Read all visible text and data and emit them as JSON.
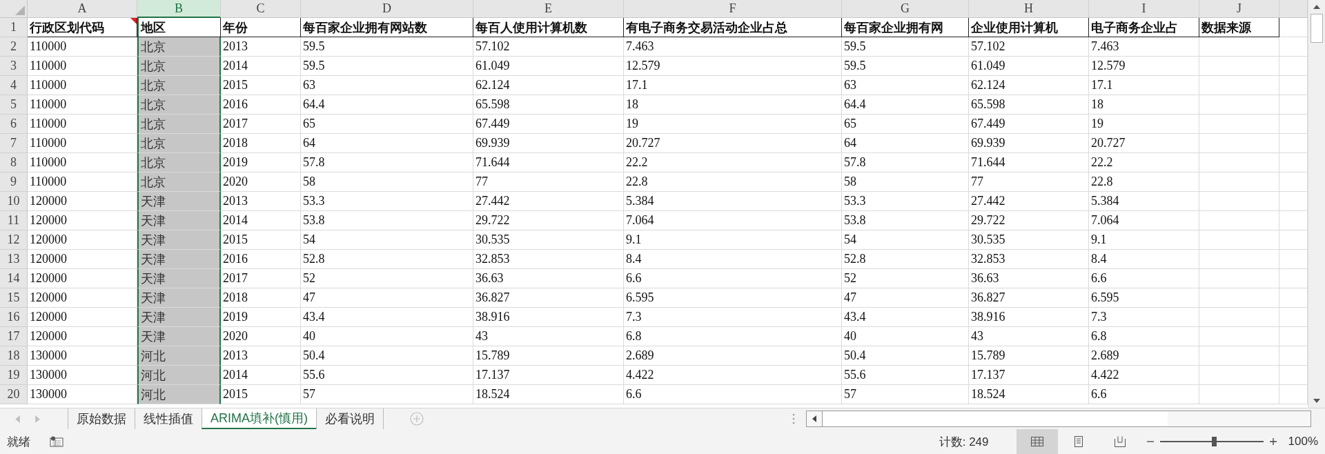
{
  "columns": [
    {
      "letter": "A",
      "selected": false
    },
    {
      "letter": "B",
      "selected": true
    },
    {
      "letter": "C",
      "selected": false
    },
    {
      "letter": "D",
      "selected": false
    },
    {
      "letter": "E",
      "selected": false
    },
    {
      "letter": "F",
      "selected": false
    },
    {
      "letter": "G",
      "selected": false
    },
    {
      "letter": "H",
      "selected": false
    },
    {
      "letter": "I",
      "selected": false
    },
    {
      "letter": "J",
      "selected": false
    }
  ],
  "header_row": {
    "number": "1",
    "cells": [
      {
        "text": "行政区划代码",
        "comment": true
      },
      {
        "text": "地区",
        "comment": false
      },
      {
        "text": "年份",
        "comment": false
      },
      {
        "text": "每百家企业拥有网站数",
        "comment": false
      },
      {
        "text": "每百人使用计算机数",
        "comment": false
      },
      {
        "text": "有电子商务交易活动企业占总",
        "comment": false
      },
      {
        "text": "每百家企业拥有网",
        "comment": false
      },
      {
        "text": "企业使用计算机",
        "comment": false
      },
      {
        "text": "电子商务企业占",
        "comment": false
      },
      {
        "text": "数据来源",
        "comment": false
      }
    ]
  },
  "rows": [
    {
      "number": "2",
      "cells": [
        "110000",
        "北京",
        "2013",
        "59.5",
        "57.102",
        "7.463",
        "59.5",
        "57.102",
        "7.463"
      ]
    },
    {
      "number": "3",
      "cells": [
        "110000",
        "北京",
        "2014",
        "59.5",
        "61.049",
        "12.579",
        "59.5",
        "61.049",
        "12.579"
      ]
    },
    {
      "number": "4",
      "cells": [
        "110000",
        "北京",
        "2015",
        "63",
        "62.124",
        "17.1",
        "63",
        "62.124",
        "17.1"
      ]
    },
    {
      "number": "5",
      "cells": [
        "110000",
        "北京",
        "2016",
        "64.4",
        "65.598",
        "18",
        "64.4",
        "65.598",
        "18"
      ]
    },
    {
      "number": "6",
      "cells": [
        "110000",
        "北京",
        "2017",
        "65",
        "67.449",
        "19",
        "65",
        "67.449",
        "19"
      ]
    },
    {
      "number": "7",
      "cells": [
        "110000",
        "北京",
        "2018",
        "64",
        "69.939",
        "20.727",
        "64",
        "69.939",
        "20.727"
      ]
    },
    {
      "number": "8",
      "cells": [
        "110000",
        "北京",
        "2019",
        "57.8",
        "71.644",
        "22.2",
        "57.8",
        "71.644",
        "22.2"
      ]
    },
    {
      "number": "9",
      "cells": [
        "110000",
        "北京",
        "2020",
        "58",
        "77",
        "22.8",
        "58",
        "77",
        "22.8"
      ]
    },
    {
      "number": "10",
      "cells": [
        "120000",
        "天津",
        "2013",
        "53.3",
        "27.442",
        "5.384",
        "53.3",
        "27.442",
        "5.384"
      ]
    },
    {
      "number": "11",
      "cells": [
        "120000",
        "天津",
        "2014",
        "53.8",
        "29.722",
        "7.064",
        "53.8",
        "29.722",
        "7.064"
      ]
    },
    {
      "number": "12",
      "cells": [
        "120000",
        "天津",
        "2015",
        "54",
        "30.535",
        "9.1",
        "54",
        "30.535",
        "9.1"
      ]
    },
    {
      "number": "13",
      "cells": [
        "120000",
        "天津",
        "2016",
        "52.8",
        "32.853",
        "8.4",
        "52.8",
        "32.853",
        "8.4"
      ]
    },
    {
      "number": "14",
      "cells": [
        "120000",
        "天津",
        "2017",
        "52",
        "36.63",
        "6.6",
        "52",
        "36.63",
        "6.6"
      ]
    },
    {
      "number": "15",
      "cells": [
        "120000",
        "天津",
        "2018",
        "47",
        "36.827",
        "6.595",
        "47",
        "36.827",
        "6.595"
      ]
    },
    {
      "number": "16",
      "cells": [
        "120000",
        "天津",
        "2019",
        "43.4",
        "38.916",
        "7.3",
        "43.4",
        "38.916",
        "7.3"
      ]
    },
    {
      "number": "17",
      "cells": [
        "120000",
        "天津",
        "2020",
        "40",
        "43",
        "6.8",
        "40",
        "43",
        "6.8"
      ]
    },
    {
      "number": "18",
      "cells": [
        "130000",
        "河北",
        "2013",
        "50.4",
        "15.789",
        "2.689",
        "50.4",
        "15.789",
        "2.689"
      ]
    },
    {
      "number": "19",
      "cells": [
        "130000",
        "河北",
        "2014",
        "55.6",
        "17.137",
        "4.422",
        "55.6",
        "17.137",
        "4.422"
      ]
    },
    {
      "number": "20",
      "cells": [
        "130000",
        "河北",
        "2015",
        "57",
        "18.524",
        "6.6",
        "57",
        "18.524",
        "6.6"
      ]
    }
  ],
  "sheet_tabs": [
    {
      "label": "原始数据",
      "selected": false
    },
    {
      "label": "线性插值",
      "selected": false
    },
    {
      "label": "ARIMA填补(慎用)",
      "selected": true
    },
    {
      "label": "必看说明",
      "selected": false
    }
  ],
  "status_bar": {
    "status": "就绪",
    "count": "计数: 249",
    "views": [
      {
        "kind": "normal",
        "selected": true
      },
      {
        "kind": "layout",
        "selected": false
      },
      {
        "kind": "pagebreak",
        "selected": false
      }
    ],
    "zoom": {
      "level": 0.52,
      "reading": "100%"
    }
  }
}
